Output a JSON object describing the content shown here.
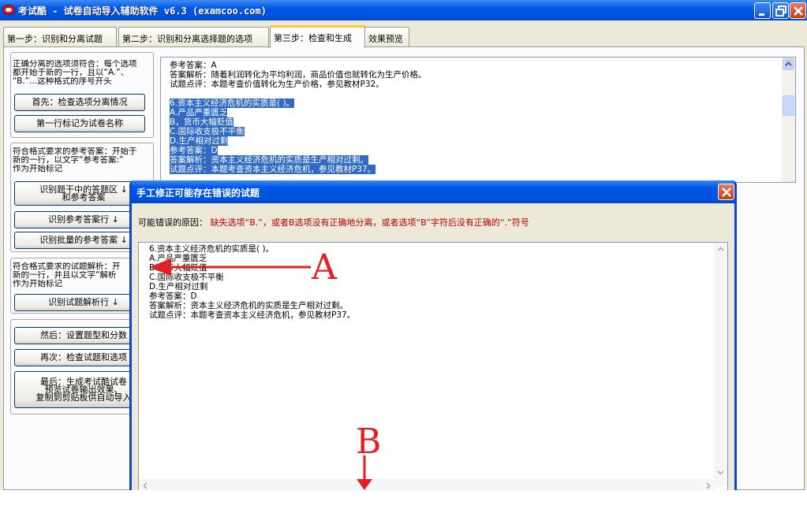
{
  "window": {
    "title": "考试酷 - 试卷自动导入辅助软件 v6.3 (examcoo.com)"
  },
  "tabs": [
    {
      "label": "第一步：识别和分离试题"
    },
    {
      "label": "第二步：识别和分离选择题的选项"
    },
    {
      "label": "第三步：检查和生成"
    },
    {
      "label": "效果预览"
    }
  ],
  "active_tab": "第三步：检查和生成",
  "left_panel": {
    "group1": {
      "text": [
        "正确分离的选项须符合：每个选项",
        "都开始于新的一行，且以“A.”、",
        "“B.”...这种格式的序号开头"
      ],
      "buttons": [
        "首先：检查选项分离情况",
        "第一行标记为试卷名称"
      ]
    },
    "group2": {
      "text": [
        "符合格式要求的参考答案：开始于",
        "新的一行，以文字“参考答案:”",
        "作为开始标记"
      ],
      "buttons": [
        "识别题干中的答题区  ↓\n和参考答案",
        "识别参考答案行  ↓",
        "识别批量的参考答案  ↓"
      ]
    },
    "group3": {
      "text": [
        "符合格式要求的试题解析：开",
        "新的一行，并且以文字“解析",
        "作为开始标记"
      ],
      "buttons": [
        "识别试题解析行  ↓"
      ]
    },
    "group4": {
      "buttons": [
        "然后：设置题型和分数",
        "再次：检查试题和选项",
        "最后：生成考试酷试卷\n预览试卷输出效果、\n复制到剪贴板供自动导入"
      ]
    }
  },
  "main_text": {
    "lines": [
      {
        "text": "参考答案：A",
        "selected": false
      },
      {
        "text": "答案解析：随着利润转化为平均利润，商品价值也就转化为生产价格。",
        "selected": false
      },
      {
        "text": "试题点评：本题考查价值转化为生产价格，参见教材P32。",
        "selected": false
      },
      {
        "text": "",
        "selected": false
      },
      {
        "text": "6.资本主义经济危机的实质是(   )。",
        "selected": true
      },
      {
        "text": "A.产品严重匮乏",
        "selected": true
      },
      {
        "text": "B，货币大幅贬值",
        "selected": true
      },
      {
        "text": "C.国际收支极不平衡",
        "selected": true
      },
      {
        "text": "D.生产相对过剩",
        "selected": true
      },
      {
        "text": "参考答案：D",
        "selected": true
      },
      {
        "text": "答案解析：资本主义经济危机的实质是生产相对过剩。",
        "selected": true
      },
      {
        "text": "试题点评：本题考查资本主义经济危机，参见教材P37。",
        "selected": true
      }
    ]
  },
  "dialog": {
    "title": "手工修正可能存在错误的试题",
    "reason_label": "可能错误的原因：",
    "reason_text": "缺失选项“B.”，或者B选项没有正确地分离，或者选项“B”字符后没有正确的“.”符号",
    "lines": [
      "6.资本主义经济危机的实质是(   )。",
      "A.产品严重匮乏",
      "B.货币大幅贬值",
      "C.国际收支极不平衡",
      "D.生产相对过剩",
      "参考答案：D",
      "答案解析：资本主义经济危机的实质是生产相对过剩。",
      "试题点评：本题考查资本主义经济危机，参见教材P37。"
    ]
  },
  "annotations": {
    "label_a": "A",
    "label_b": "B",
    "color": "#e31e24"
  },
  "colors": {
    "titlebar": "#0058e6",
    "selection": "#316ac5",
    "reason": "#c00000",
    "active_tab_accent": "#ffc83c"
  }
}
